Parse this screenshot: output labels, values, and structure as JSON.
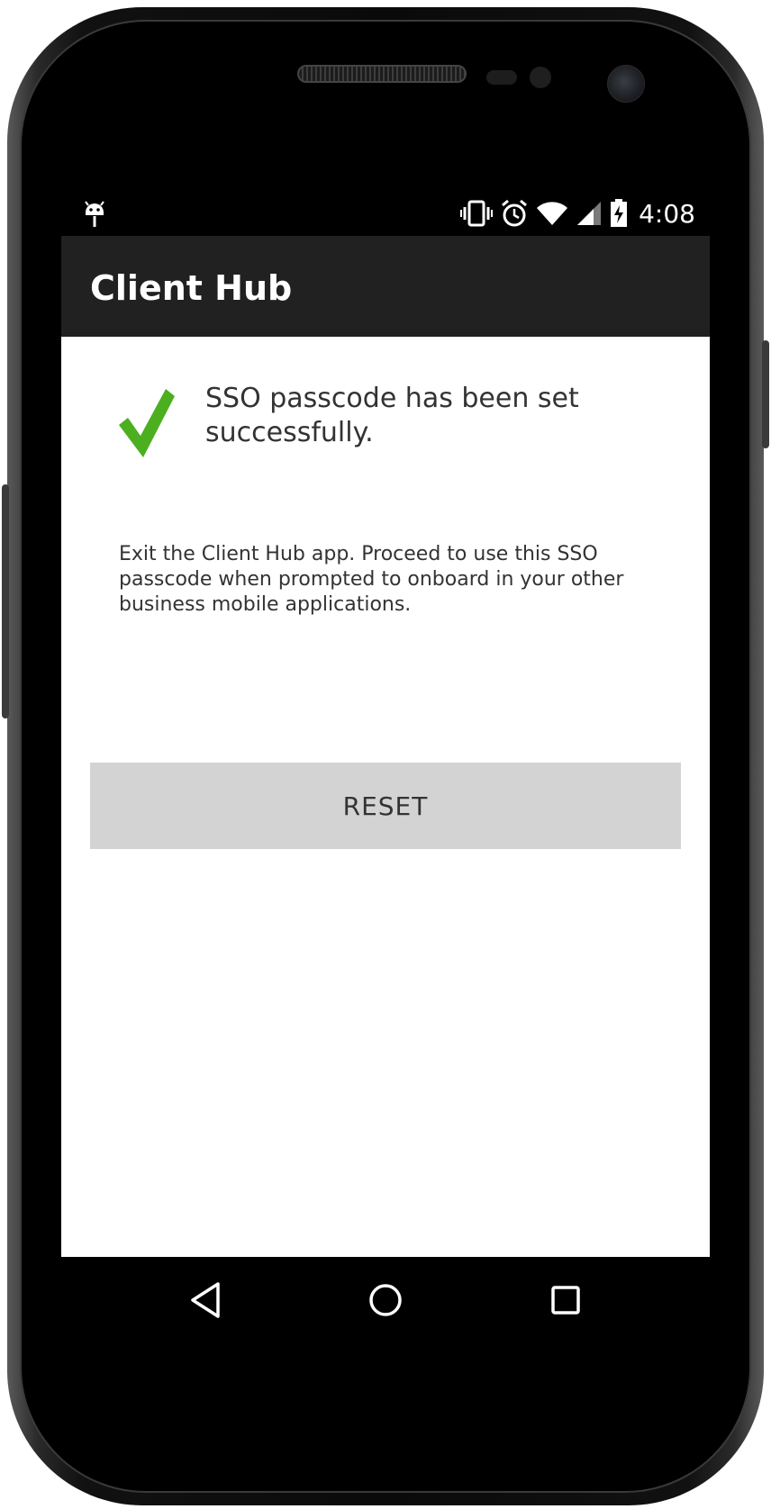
{
  "status_bar": {
    "time": "4:08",
    "icons": [
      "android-debug-icon",
      "vibrate-icon",
      "alarm-icon",
      "wifi-icon",
      "signal-icon",
      "battery-charging-icon"
    ]
  },
  "app_bar": {
    "title": "Client Hub"
  },
  "content": {
    "success_message": "SSO passcode has been set successfully.",
    "instructions": "Exit the Client Hub app. Proceed to use this SSO passcode when prompted to onboard in your other business mobile applications.",
    "reset_label": "RESET"
  },
  "nav_bar": {
    "buttons": [
      "back-icon",
      "home-icon",
      "recents-icon"
    ]
  },
  "colors": {
    "app_bar": "#212121",
    "check": "#4caf1f",
    "button_bg": "#d3d3d3",
    "text": "#333333"
  }
}
